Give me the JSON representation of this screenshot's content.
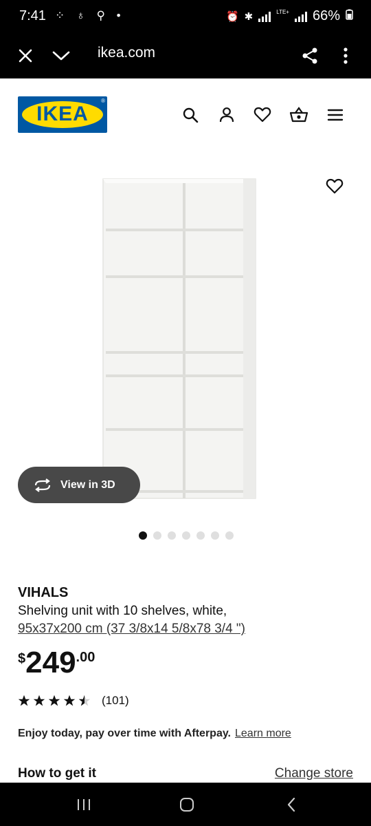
{
  "status_bar": {
    "time": "7:41",
    "left_icons": "⁘ ♁ ⚲ •",
    "network": "LTE+",
    "battery": "66%"
  },
  "browser": {
    "url": "ikea.com",
    "icons": [
      "close-icon",
      "chevron-down-icon",
      "share-icon",
      "more-vert-icon"
    ]
  },
  "header": {
    "logo_text": "IKEA",
    "logo_mark": "®",
    "icons": [
      "search-icon",
      "account-icon",
      "heart-icon",
      "basket-icon",
      "menu-icon"
    ],
    "colors": {
      "logo_blue": "#0058A3",
      "logo_yellow": "#FFDB00"
    }
  },
  "gallery": {
    "view3d_label": "View in 3D",
    "image_count": 7,
    "active_index": 0
  },
  "product": {
    "name": "VIHALS",
    "description": "Shelving unit with 10 shelves, white,",
    "dimensions": "95x37x200 cm (37 3/8x14 5/8x78 3/4 \")",
    "price_currency": "$",
    "price_integer": "249",
    "price_decimal": ".00",
    "rating_value": 4.5,
    "rating_count": "(101)"
  },
  "afterpay": {
    "text": "Enjoy today, pay over time with Afterpay.",
    "link": "Learn more"
  },
  "fulfillment": {
    "title": "How to get it",
    "change_store": "Change store"
  },
  "nav_bar": {
    "icons": [
      "recent-apps-icon",
      "home-icon",
      "back-icon"
    ]
  }
}
